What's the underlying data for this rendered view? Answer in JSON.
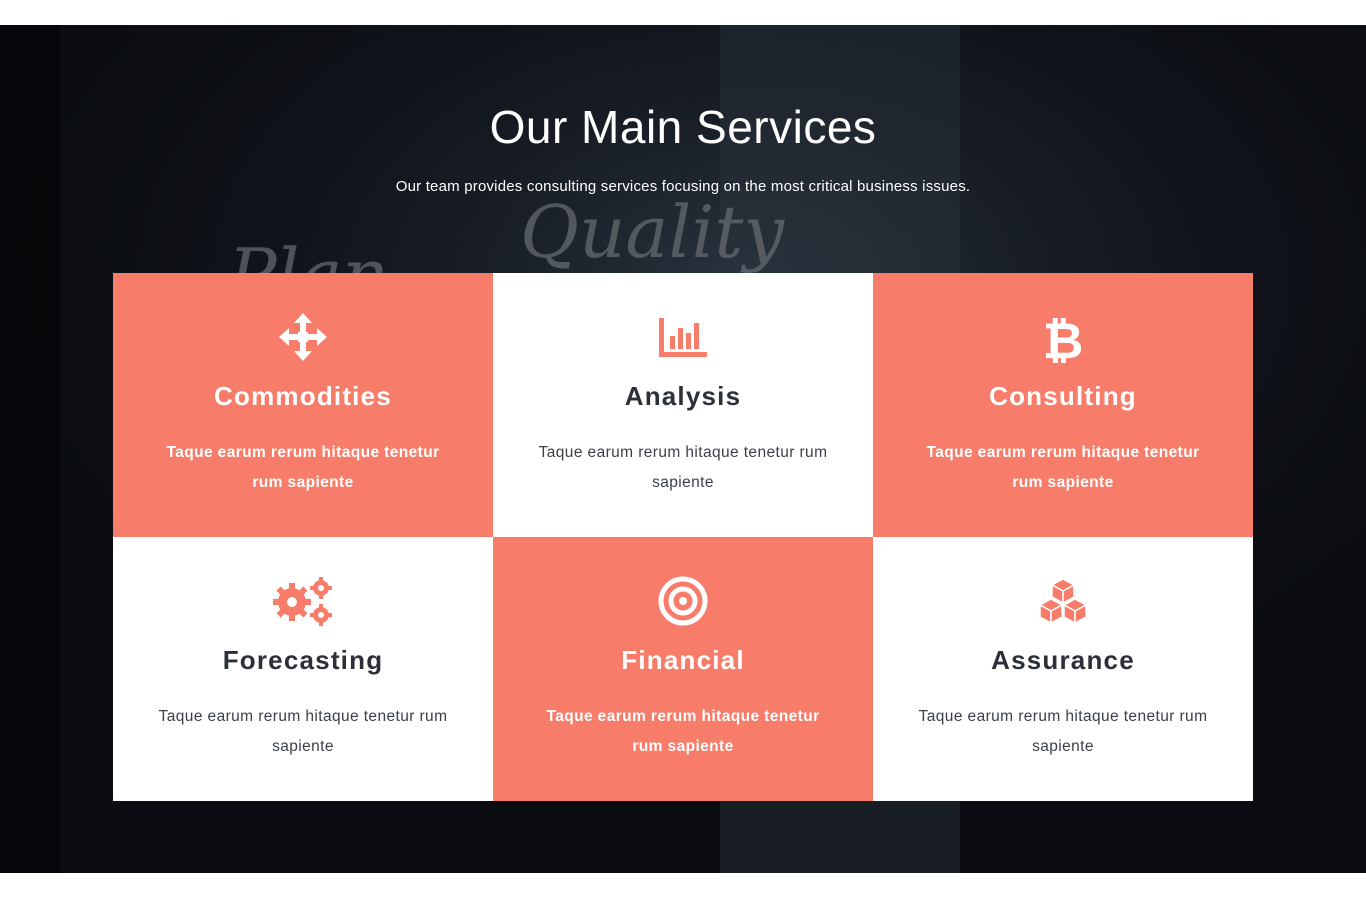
{
  "section": {
    "heading": "Our Main Services",
    "subheading": "Our team provides consulting services focusing on the most critical business issues.",
    "background_words": [
      "Quality",
      "Plan"
    ]
  },
  "colors": {
    "accent": "#f77c69",
    "dark_bg": "#0b0d12",
    "card_white": "#ffffff",
    "text_dark": "#2c3039"
  },
  "services": [
    {
      "title": "Commodities",
      "description": "Taque earum rerum hitaque tenetur rum sapiente",
      "icon": "arrows-move-icon",
      "style": "accent"
    },
    {
      "title": "Analysis",
      "description": "Taque earum rerum hitaque tenetur rum sapiente",
      "icon": "bar-chart-icon",
      "style": "plain"
    },
    {
      "title": "Consulting",
      "description": "Taque earum rerum hitaque tenetur rum sapiente",
      "icon": "bitcoin-icon",
      "style": "accent"
    },
    {
      "title": "Forecasting",
      "description": "Taque earum rerum hitaque tenetur rum sapiente",
      "icon": "gears-icon",
      "style": "plain"
    },
    {
      "title": "Financial",
      "description": "Taque earum rerum hitaque tenetur rum sapiente",
      "icon": "target-icon",
      "style": "accent"
    },
    {
      "title": "Assurance",
      "description": "Taque earum rerum hitaque tenetur rum sapiente",
      "icon": "cubes-icon",
      "style": "plain"
    }
  ]
}
